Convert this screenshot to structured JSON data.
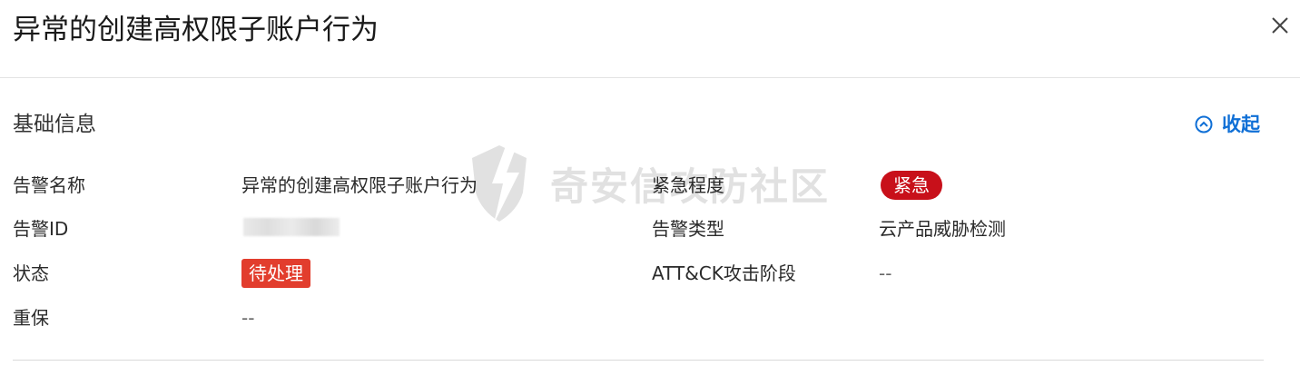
{
  "header": {
    "title": "异常的创建高权限子账户行为"
  },
  "section": {
    "title": "基础信息",
    "collapse_label": "收起"
  },
  "fields": {
    "alert_name": {
      "label": "告警名称",
      "value": "异常的创建高权限子账户行为"
    },
    "alert_id": {
      "label": "告警ID"
    },
    "status": {
      "label": "状态",
      "value": "待处理"
    },
    "protection": {
      "label": "重保",
      "value": "--"
    },
    "severity": {
      "label": "紧急程度",
      "value": "紧急"
    },
    "alert_type": {
      "label": "告警类型",
      "value": "云产品威胁检测"
    },
    "attck_stage": {
      "label": "ATT&CK攻击阶段",
      "value": "--"
    }
  },
  "watermark": {
    "text": "奇安信攻防社区"
  },
  "colors": {
    "accent": "#0f6fd6",
    "urgent_badge": "#c8101a",
    "status_badge": "#e23d2d"
  },
  "icons": {
    "close": "close-icon",
    "collapse": "chevron-up-circle-icon",
    "watermark_logo": "shield-icon"
  }
}
